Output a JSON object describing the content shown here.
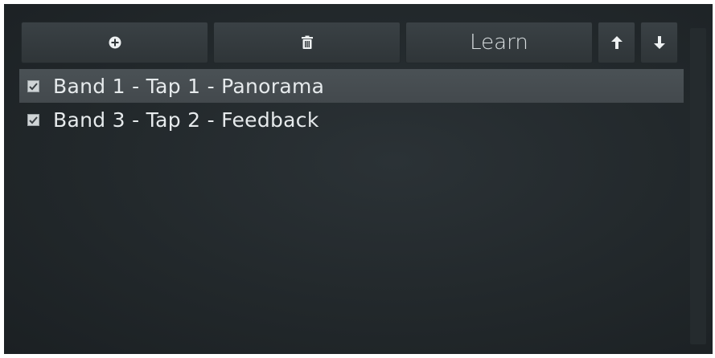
{
  "toolbar": {
    "add_icon": "plus-circle-icon",
    "delete_icon": "trash-icon",
    "learn_label": "Learn",
    "up_icon": "arrow-up-icon",
    "down_icon": "arrow-down-icon"
  },
  "list": {
    "items": [
      {
        "label": "Band 1 - Tap 1 - Panorama",
        "checked": true,
        "selected": true
      },
      {
        "label": "Band 3 - Tap 2 - Feedback",
        "checked": true,
        "selected": false
      }
    ]
  },
  "colors": {
    "background": "#22282b",
    "button": "#353b3f",
    "selected_row": "#464c50",
    "text": "#e6eaec"
  }
}
